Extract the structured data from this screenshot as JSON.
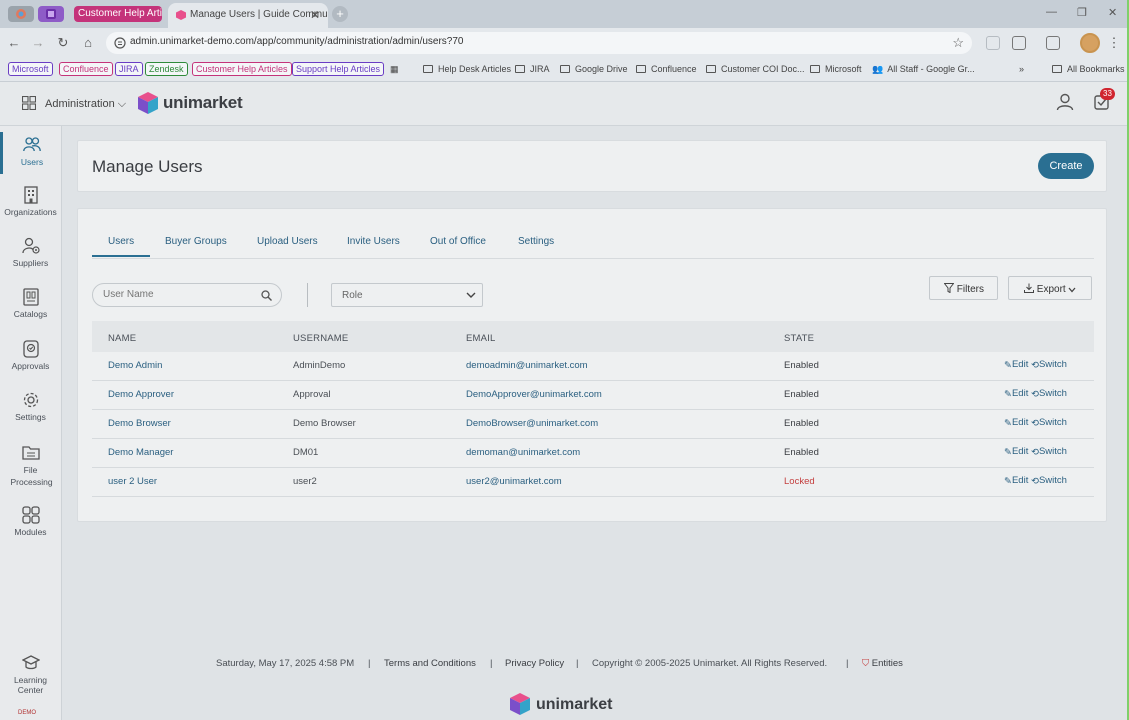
{
  "browser": {
    "tabs": [
      {
        "label": "Customer Help Article",
        "color": "#c4337a"
      },
      {
        "label": "Manage Users | Guide Commu",
        "active": true
      }
    ],
    "url": "admin.unimarket-demo.com/app/community/administration/admin/users?70",
    "bookmarks": [
      {
        "label": "Microsoft",
        "color": "#6a3dc4"
      },
      {
        "label": "Confluence",
        "color": "#c4337a"
      },
      {
        "label": "JIRA",
        "color": "#6a3dc4"
      },
      {
        "label": "Zendesk",
        "color": "#2f8a3a"
      },
      {
        "label": "Customer Help Articles",
        "color": "#c4337a"
      },
      {
        "label": "Support Help Articles",
        "color": "#6a3dc4"
      }
    ],
    "bookmark_folders": [
      "Help Desk Articles",
      "JIRA",
      "Google Drive",
      "Confluence",
      "Customer COI Doc...",
      "Microsoft",
      "All Staff - Google Gr..."
    ],
    "all_bookmarks": "All Bookmarks"
  },
  "header": {
    "module": "Administration",
    "brand": "unimarket",
    "tasks_count": "33"
  },
  "sidebar": {
    "items": [
      {
        "label": "Users",
        "icon": "users-icon",
        "active": true
      },
      {
        "label": "Organizations",
        "icon": "building-icon"
      },
      {
        "label": "Suppliers",
        "icon": "suppliers-icon"
      },
      {
        "label": "Catalogs",
        "icon": "catalog-icon"
      },
      {
        "label": "Approvals",
        "icon": "approval-icon"
      },
      {
        "label": "Settings",
        "icon": "gear-icon"
      },
      {
        "label": "File Processing",
        "icon": "file-processing-icon"
      },
      {
        "label": "Modules",
        "icon": "modules-icon"
      },
      {
        "label": "Learning Center",
        "icon": "graduation-cap-icon"
      }
    ],
    "demo_tag": "DEMO"
  },
  "page": {
    "title": "Manage Users",
    "create_label": "Create"
  },
  "tabs": [
    "Users",
    "Buyer Groups",
    "Upload Users",
    "Invite Users",
    "Out of Office",
    "Settings"
  ],
  "filters": {
    "search_placeholder": "User Name",
    "role_placeholder": "Role",
    "filters_label": "Filters",
    "export_label": "Export"
  },
  "table": {
    "columns": [
      "NAME",
      "USERNAME",
      "EMAIL",
      "STATE"
    ],
    "rows": [
      {
        "name": "Demo Admin",
        "username": "AdminDemo",
        "email": "demoadmin@unimarket.com",
        "state": "Enabled"
      },
      {
        "name": "Demo Approver",
        "username": "Approval",
        "email": "DemoApprover@unimarket.com",
        "state": "Enabled"
      },
      {
        "name": "Demo Browser",
        "username": "Demo Browser",
        "email": "DemoBrowser@unimarket.com",
        "state": "Enabled"
      },
      {
        "name": "Demo Manager",
        "username": "DM01",
        "email": "demoman@unimarket.com",
        "state": "Enabled"
      },
      {
        "name": "user 2 User",
        "username": "user2",
        "email": "user2@unimarket.com",
        "state": "Locked"
      }
    ],
    "edit_label": "Edit",
    "switch_label": "Switch"
  },
  "footer": {
    "datetime": "Saturday, May 17, 2025 4:58 PM",
    "terms": "Terms and Conditions",
    "privacy": "Privacy Policy",
    "copyright": "Copyright © 2005-2025 Unimarket. All Rights Reserved.",
    "entities": "Entities",
    "brand": "unimarket"
  },
  "colors": {
    "accent": "#2a6f92",
    "link": "#2a5f80",
    "locked": "#c44040",
    "badge": "#d0252f"
  }
}
